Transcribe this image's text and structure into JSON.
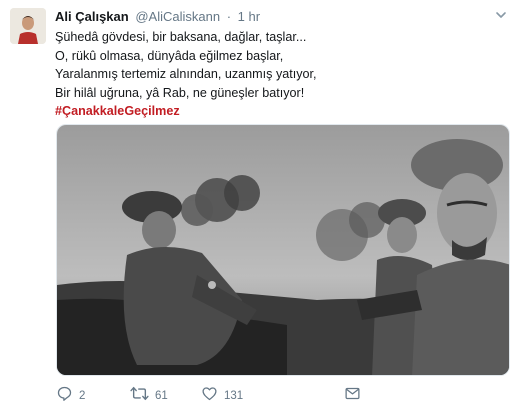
{
  "tweet": {
    "author_name": "Ali Çalışkan",
    "author_handle": "@AliCaliskann",
    "separator": "·",
    "time": "1 hr",
    "lines": [
      "Şühedâ gövdesi, bir baksana, dağlar, taşlar...",
      "O, rükû olmasa, dünyâda eğilmez başlar,",
      "Yaralanmış tertemiz alnından, uzanmış yatıyor,",
      "Bir hilâl uğruna, yâ Rab, ne güneşler batıyor!"
    ],
    "hashtag": "#ÇanakkaleGeçilmez"
  },
  "actions": {
    "reply_count": "2",
    "retweet_count": "61",
    "like_count": "131"
  },
  "icons": {
    "caret": "chevron-down-icon",
    "reply": "reply-icon",
    "retweet": "retweet-icon",
    "like": "heart-icon",
    "dm": "envelope-icon"
  },
  "colors": {
    "hashtag": "#c21d23",
    "secondary_text": "#657786",
    "icon": "#657786"
  }
}
